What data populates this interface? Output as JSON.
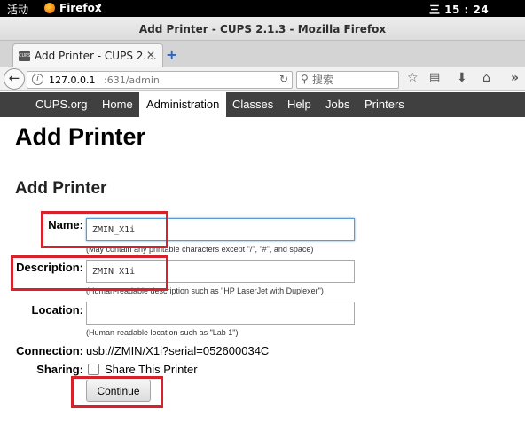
{
  "os_bar": {
    "activities": "活动",
    "app_name": "Firefox",
    "caret": "▾",
    "clock": "三 15 : 24"
  },
  "window": {
    "title": "Add Printer - CUPS 2.1.3 - Mozilla Firefox"
  },
  "tabs": [
    {
      "label": "Add Printer - CUPS 2....",
      "favicon": "CUPS",
      "close": "✕"
    }
  ],
  "new_tab": "+",
  "toolbar": {
    "url_host": "127.0.0.1",
    "url_path": ":631/admin",
    "search_placeholder": "搜索",
    "icons": [
      "back-arrow-icon",
      "info-icon",
      "reload-icon",
      "search-icon",
      "bookmark-star-icon",
      "reading-list-icon",
      "download-icon",
      "home-icon",
      "overflow-chevron-icon"
    ]
  },
  "cups_nav": [
    {
      "label": "CUPS.org",
      "active": false
    },
    {
      "label": "Home",
      "active": false
    },
    {
      "label": "Administration",
      "active": true
    },
    {
      "label": "Classes",
      "active": false
    },
    {
      "label": "Help",
      "active": false
    },
    {
      "label": "Jobs",
      "active": false
    },
    {
      "label": "Printers",
      "active": false
    }
  ],
  "page": {
    "title": "Add Printer",
    "section_title": "Add Printer"
  },
  "form": {
    "name_label": "Name:",
    "name_value": "ZMIN_X1i",
    "name_hint": "(May contain any printable characters except \"/\", \"#\", and space)",
    "description_label": "Description:",
    "description_value": "ZMIN X1i",
    "description_hint": "(Human-readable description such as \"HP LaserJet with Duplexer\")",
    "location_label": "Location:",
    "location_value": "",
    "location_hint": "(Human-readable location such as \"Lab 1\")",
    "connection_label": "Connection:",
    "connection_value": "usb://ZMIN/X1i?serial=052600034C",
    "sharing_label": "Sharing:",
    "share_checkbox_label": "Share This Printer",
    "share_checked": false,
    "continue_label": "Continue"
  },
  "colors": {
    "nav_background": "#404040",
    "highlight_box": "#d6222a",
    "focus_border": "#5b9bd5"
  }
}
